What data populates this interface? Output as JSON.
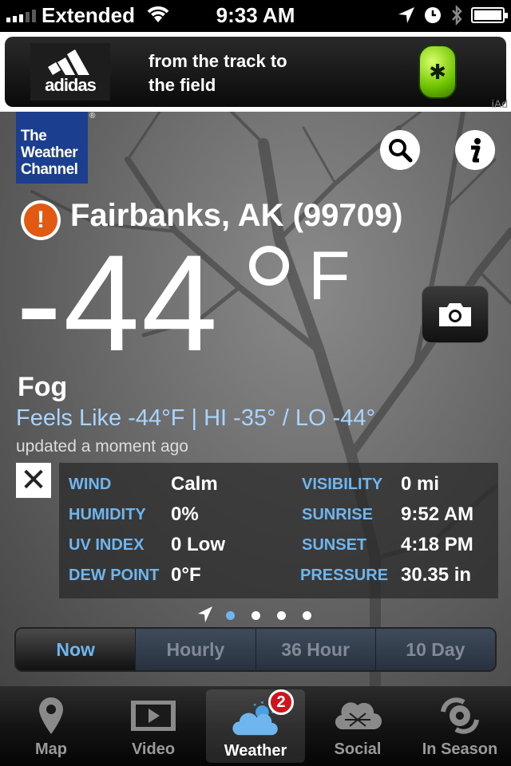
{
  "status_bar": {
    "carrier": "Extended",
    "time": "9:33 AM"
  },
  "ad": {
    "brand": "adidas",
    "headline_line1": "from the track to",
    "headline_line2": "the field",
    "iad_label": "iAd"
  },
  "logo": {
    "line1": "The",
    "line2": "Weather",
    "line3": "Channel"
  },
  "header": {
    "search_icon": "search-icon",
    "info_icon": "info-icon"
  },
  "location": {
    "alert_icon": "alert-icon",
    "name": "Fairbanks, AK (99709)"
  },
  "current": {
    "temperature": "-44",
    "unit": "F",
    "condition": "Fog",
    "feels_like": "Feels Like -44°F | HI -35° / LO -44°",
    "updated": "updated a moment ago"
  },
  "details": {
    "rows": [
      {
        "label_left": "WIND",
        "value_left": "Calm",
        "label_right": "VISIBILITY",
        "value_right": "0 mi"
      },
      {
        "label_left": "HUMIDITY",
        "value_left": "0%",
        "label_right": "SUNRISE",
        "value_right": "9:52 AM"
      },
      {
        "label_left": "UV INDEX",
        "value_left": "0 Low",
        "label_right": "SUNSET",
        "value_right": "4:18 PM"
      },
      {
        "label_left": "DEW POINT",
        "value_left": "0°F",
        "label_right": "PRESSURE",
        "value_right": "30.35 in"
      }
    ]
  },
  "pager": {
    "current_index": 0,
    "page_count": 4
  },
  "segments": [
    {
      "label": "Now",
      "active": true
    },
    {
      "label": "Hourly",
      "active": false
    },
    {
      "label": "36 Hour",
      "active": false
    },
    {
      "label": "10 Day",
      "active": false
    }
  ],
  "tabbar": {
    "tabs": [
      {
        "label": "Map",
        "icon": "map-pin-icon"
      },
      {
        "label": "Video",
        "icon": "video-icon"
      },
      {
        "label": "Weather",
        "icon": "weather-icon",
        "badge": "2",
        "active": true
      },
      {
        "label": "Social",
        "icon": "social-icon"
      },
      {
        "label": "In Season",
        "icon": "hurricane-icon"
      }
    ]
  },
  "colors": {
    "accent_blue": "#6fb6ee",
    "feels_like_blue": "#a8d4ff",
    "alert_orange": "#e25a12",
    "logo_blue": "#1b3e8f",
    "badge_red": "#d0141e"
  }
}
